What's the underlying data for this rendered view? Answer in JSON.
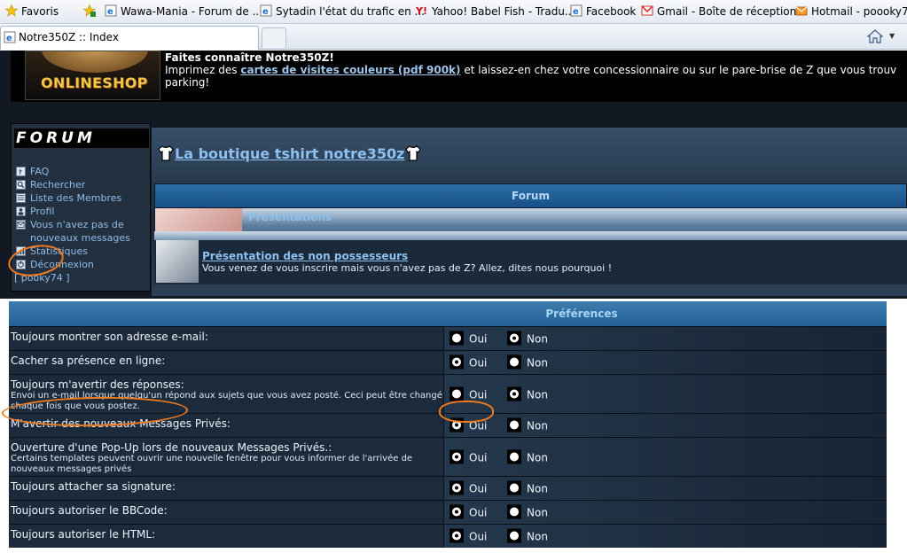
{
  "browser": {
    "favorites_label": "Favoris",
    "favorites_bar": [
      {
        "label": "Wawa-Mania - Forum de ...",
        "icon": "ie-page-icon"
      },
      {
        "label": "Sytadin  l'état du trafic en ...",
        "icon": "ie-page-icon"
      },
      {
        "label": "Yahoo! Babel Fish - Tradu...",
        "icon": "yahoo-icon"
      },
      {
        "label": "Facebook",
        "icon": "ie-page-icon"
      },
      {
        "label": "Gmail - Boîte de réception...",
        "icon": "gmail-icon"
      },
      {
        "label": "Hotmail - poooky74",
        "icon": "hotmail-icon"
      }
    ],
    "tab_title": "Notre350Z :: Index"
  },
  "header": {
    "shop_logo": "ONLINESHOP",
    "title": "Faites connaître Notre350Z!",
    "text_before_link": "Imprimez des ",
    "link": "cartes de visites couleurs (pdf 900k)",
    "text_after_link": " et laissez-en chez votre concessionnaire ou sur le pare-brise de Z que vous trouv parking!"
  },
  "sidebar": {
    "logo": "FORUM",
    "items": [
      {
        "label": "FAQ",
        "icon": "faq-icon"
      },
      {
        "label": "Rechercher",
        "icon": "search-icon"
      },
      {
        "label": "Liste des Membres",
        "icon": "members-icon"
      },
      {
        "label": "Profil",
        "icon": "profile-icon"
      },
      {
        "label": "Vous n'avez pas de nouveaux messages",
        "icon": "messages-icon"
      },
      {
        "label": "Statistiques",
        "icon": "stats-icon"
      },
      {
        "label": "Déconnexion",
        "icon": "logout-icon"
      }
    ],
    "user": "[ pooky74 ]"
  },
  "forum": {
    "shop_link": "La boutique tshirt notre350z",
    "column_header": "Forum",
    "category": "Présentations",
    "rows": [
      {
        "title": "Présentation des non possesseurs",
        "desc": "Vous venez de vous inscrire mais vous n'avez pas de Z? Allez, dites nous pourquoi !"
      }
    ]
  },
  "preferences": {
    "header": "Préférences",
    "yes": "Oui",
    "no": "Non",
    "rows": [
      {
        "label": "Toujours montrer son adresse e-mail:",
        "sub": "",
        "value": "non"
      },
      {
        "label": "Cacher sa présence en ligne:",
        "sub": "",
        "value": "oui"
      },
      {
        "label": "Toujours m'avertir des réponses:",
        "sub": "Envoi un e-mail lorsque quelqu'un répond aux sujets que vous avez posté. Ceci peut être changé chaque fois que vous postez.",
        "value": "non"
      },
      {
        "label": "M'avertir des nouveaux Messages Privés:",
        "sub": "",
        "value": "oui"
      },
      {
        "label": "Ouverture d'une Pop-Up lors de nouveaux Messages Privés.:",
        "sub": "Certains templates peuvent ouvrir une nouvelle fenêtre pour vous informer de l'arrivée de nouveaux messages privés",
        "value": "oui"
      },
      {
        "label": "Toujours attacher sa signature:",
        "sub": "",
        "value": "oui"
      },
      {
        "label": "Toujours autoriser le BBCode:",
        "sub": "",
        "value": "oui"
      },
      {
        "label": "Toujours autoriser le HTML:",
        "sub": "",
        "value": "oui"
      }
    ]
  },
  "colors": {
    "highlight_circle": "#f07a1e",
    "link": "#8ec0ef",
    "page_bg": "#121922"
  }
}
